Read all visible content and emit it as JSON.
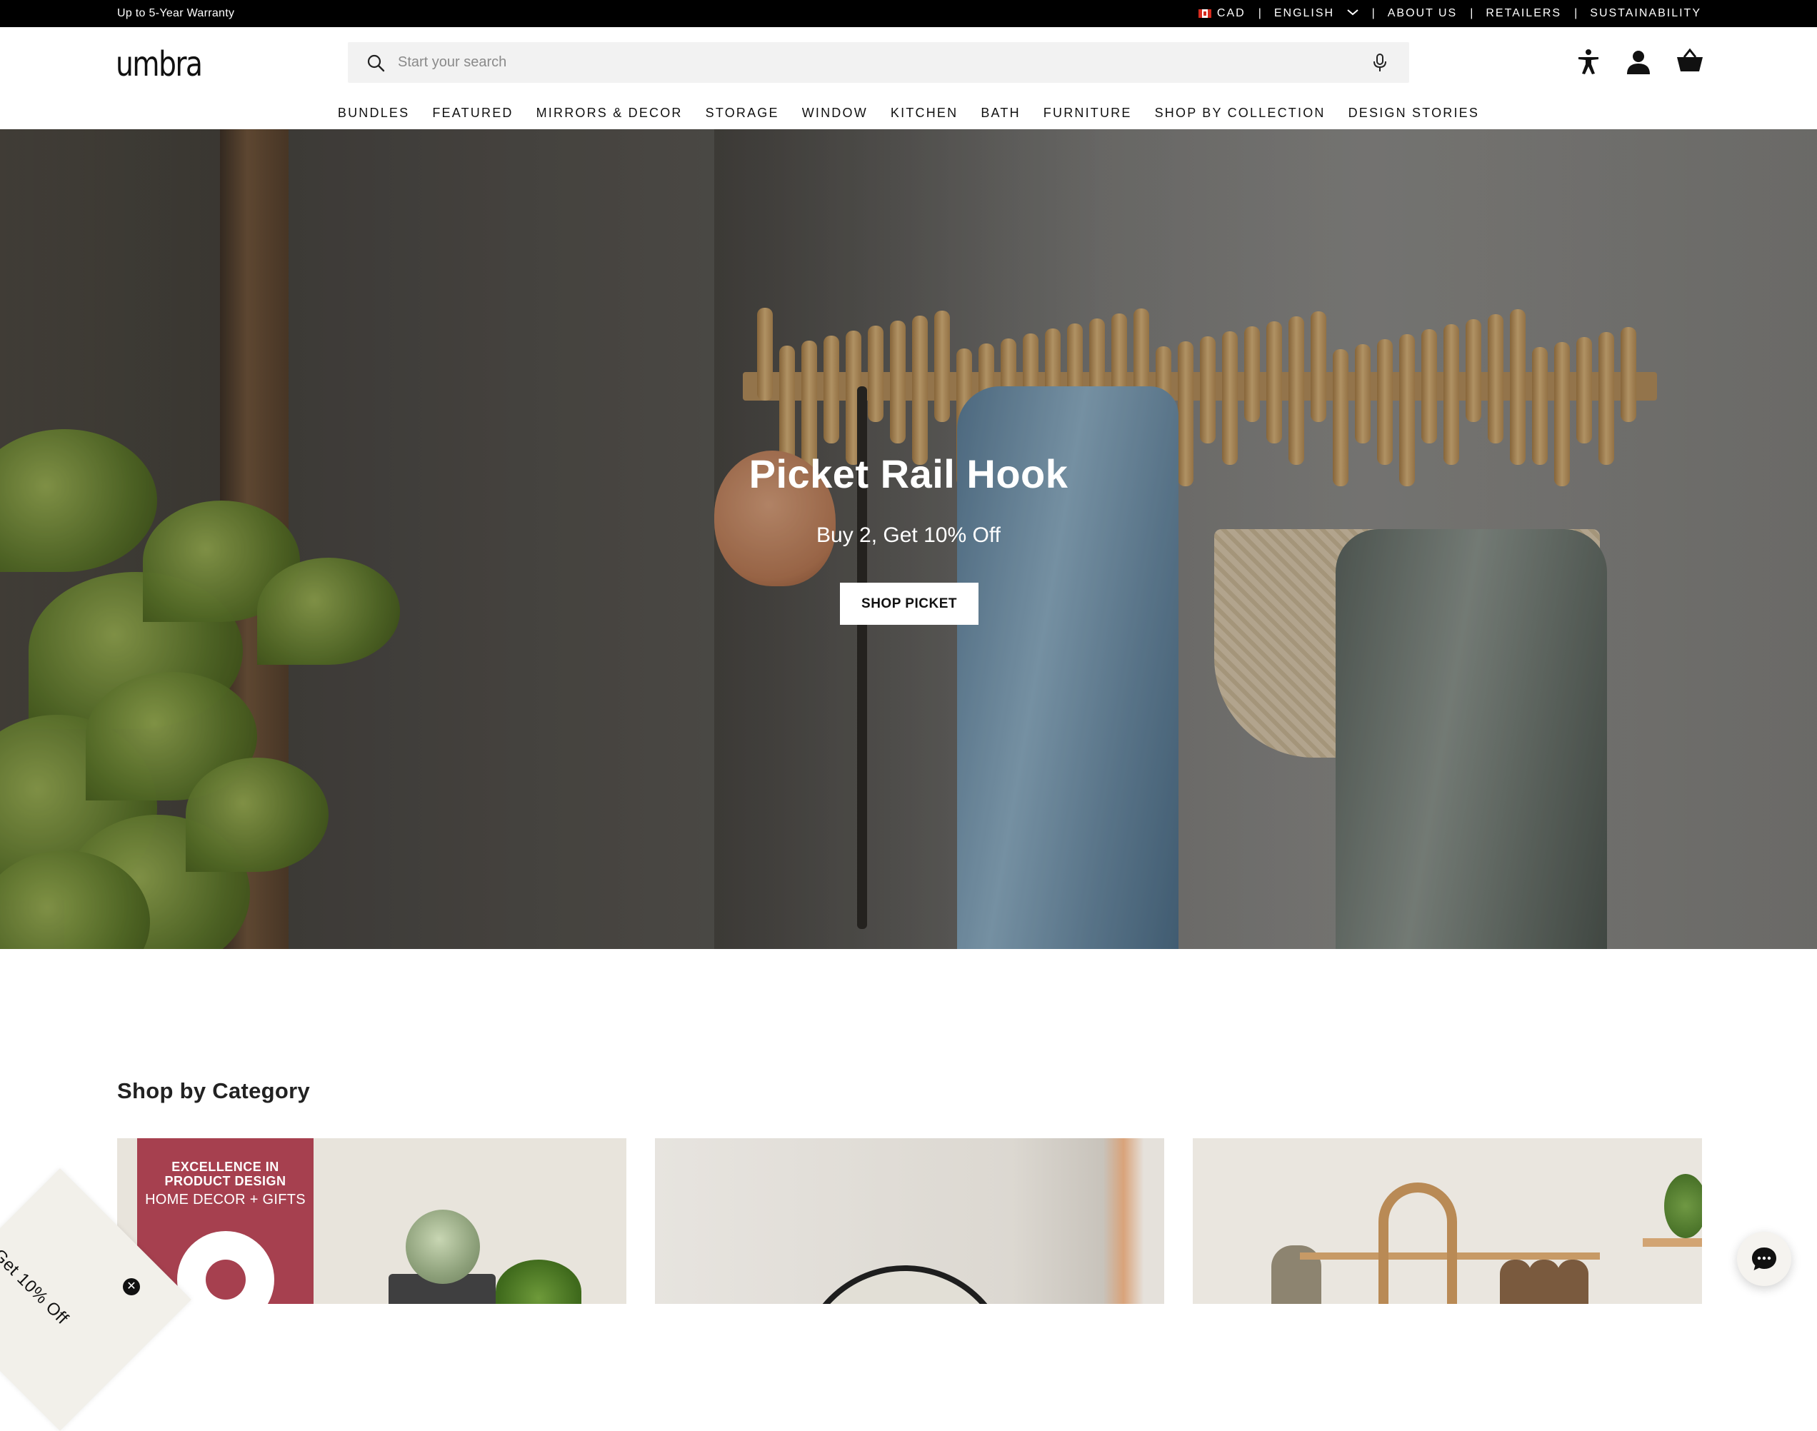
{
  "announcement": {
    "promo": "Up to 5-Year Warranty",
    "currency": "CAD",
    "language": "ENGLISH",
    "links": [
      "ABOUT US",
      "RETAILERS",
      "SUSTAINABILITY"
    ]
  },
  "header": {
    "logo": "umbra",
    "search_placeholder": "Start your search"
  },
  "nav": {
    "items": [
      "BUNDLES",
      "FEATURED",
      "MIRRORS & DECOR",
      "STORAGE",
      "WINDOW",
      "KITCHEN",
      "BATH",
      "FURNITURE",
      "SHOP BY COLLECTION",
      "DESIGN STORIES"
    ]
  },
  "hero": {
    "title": "Picket Rail Hook",
    "subtitle": "Buy 2, Get 10% Off",
    "cta": "SHOP PICKET"
  },
  "categories": {
    "title": "Shop by Category",
    "card1_badge_line1": "EXCELLENCE IN",
    "card1_badge_line2": "PRODUCT DESIGN",
    "card1_badge_line3": "HOME DECOR + GIFTS"
  },
  "widgets": {
    "discount_label": "Get 10% Off",
    "close_glyph": "✕"
  },
  "icons": {
    "search": "search-icon",
    "mic": "microphone-icon",
    "accessibility": "accessibility-icon",
    "account": "account-icon",
    "cart": "cart-icon",
    "chat": "chat-icon"
  }
}
